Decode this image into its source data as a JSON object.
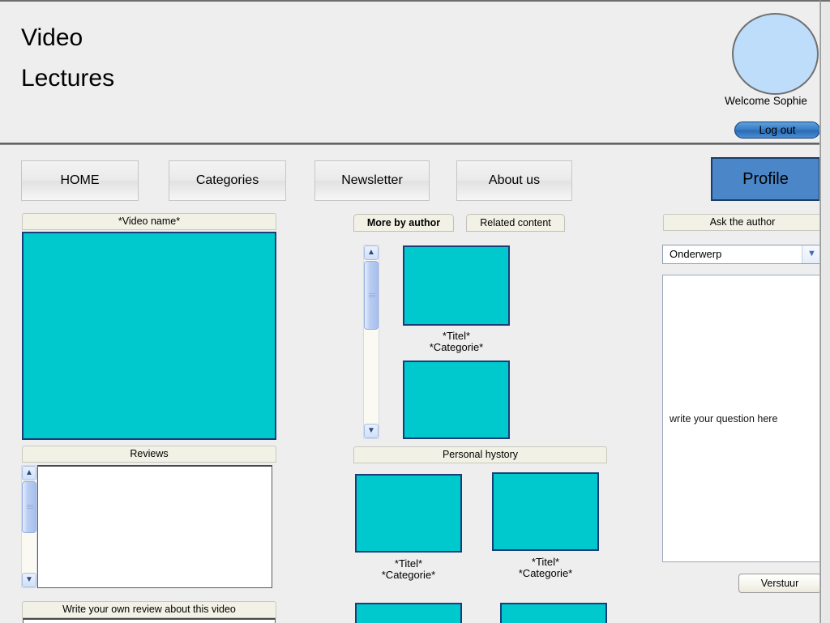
{
  "header": {
    "title_line1": "Video",
    "title_line2": "Lectures",
    "welcome": "Welcome Sophie",
    "logout_label": "Log out",
    "avatar_icon": "user-avatar-circle",
    "avatar_color": "#bdddfb"
  },
  "nav": {
    "items": [
      {
        "label": "HOME"
      },
      {
        "label": "Categories"
      },
      {
        "label": "Newsletter"
      },
      {
        "label": "About us"
      }
    ],
    "profile_label": "Profile",
    "profile_color": "#4a86c8"
  },
  "left_column": {
    "video_name_label": "*Video name*",
    "player_color": "#00c9ce",
    "reviews_label": "Reviews",
    "reviews_content": "",
    "write_review_label": "Write your own review about this video",
    "scroll_up_icon": "chevron-up-icon",
    "scroll_down_icon": "chevron-down-icon"
  },
  "middle_column": {
    "tabs": [
      {
        "label": "More by author",
        "active": true
      },
      {
        "label": "Related content",
        "active": false
      }
    ],
    "more_items": [
      {
        "title": "*Titel*",
        "category": "*Categorie*"
      },
      {
        "title": "",
        "category": ""
      }
    ],
    "history_label": "Personal hystory",
    "history_items": [
      {
        "title": "*Titel*",
        "category": "*Categorie*"
      },
      {
        "title": "*Titel*",
        "category": "*Categorie*"
      }
    ],
    "thumb_color": "#00c9ce",
    "scroll_up_icon": "chevron-up-icon",
    "scroll_down_icon": "chevron-down-icon"
  },
  "right_column": {
    "ask_label": "Ask the author",
    "topic_value": "Onderwerp",
    "topic_arrow_icon": "chevron-down-icon",
    "question_placeholder": "write your question here",
    "send_label": "Verstuur"
  }
}
